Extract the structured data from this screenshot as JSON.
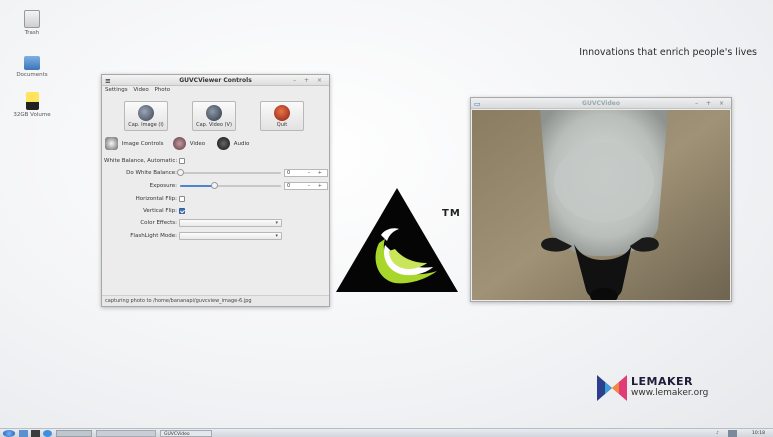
{
  "desktop": {
    "icons": [
      {
        "label": "Trash",
        "icon": "trash-icon"
      },
      {
        "label": "Documents",
        "icon": "folder-icon"
      },
      {
        "label": "32GB Volume",
        "icon": "drive-icon"
      }
    ],
    "tagline": "Innovations that enrich people's lives"
  },
  "controls_window": {
    "title": "GUVCViewer Controls",
    "window_buttons": "– + ×",
    "menu": [
      "Settings",
      "Video",
      "Photo"
    ],
    "buttons": {
      "cap_image": "Cap. Image (I)",
      "cap_video": "Cap. Video (V)",
      "quit": "Quit"
    },
    "tabs": [
      "Image Controls",
      "Video",
      "Audio"
    ],
    "controls": {
      "wb_auto_label": "White Balance, Automatic:",
      "wb_auto_checked": false,
      "wb_label": "Do White Balance:",
      "wb_value": "0",
      "wb_level": 0.0,
      "exposure_label": "Exposure:",
      "exposure_value": "0",
      "exposure_level": 0.34,
      "hflip_label": "Horizontal Flip:",
      "hflip_checked": false,
      "vflip_label": "Vertical Flip:",
      "vflip_checked": true,
      "color_effects_label": "Color Effects:",
      "color_effects_value": "",
      "flashlight_label": "FlashLight Mode:",
      "flashlight_value": "",
      "spin_buttons": "– +"
    },
    "status": "capturing photo to /home/bananapi/guvcview_image-6.jpg"
  },
  "video_window": {
    "title": "GUVCVideo",
    "window_buttons": "– + ×"
  },
  "logo": {
    "tm": "TM"
  },
  "brand": {
    "name": "LEMAKER",
    "url": "www.lemaker.org"
  },
  "taskbar": {
    "task": "GUVCVideo",
    "clock": "10:18",
    "colors": {
      "accent": "#3d73b8",
      "banana_green": "#a8d62a"
    }
  }
}
